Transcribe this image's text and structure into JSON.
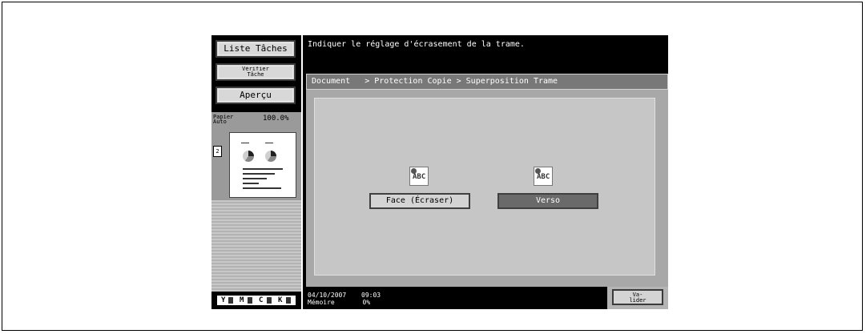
{
  "sidebar": {
    "job_list": "Liste Tâches",
    "check_job": [
      "Vérifier",
      "Tâche"
    ],
    "preview": "Aperçu",
    "paper": [
      "Papier",
      "Auto"
    ],
    "zoom": "100.0%",
    "duplex_icon": "duplex-icon",
    "toner": [
      "Y",
      "M",
      "C",
      "K"
    ]
  },
  "header": {
    "message": "Indiquer le réglage d'écrasement de la trame."
  },
  "breadcrumb": "Document   > Protection Copie > Superposition Trame",
  "options": {
    "face": {
      "label": "Face (Écraser)",
      "icon": "ABC",
      "selected": false
    },
    "verso": {
      "label": "Verso",
      "icon": "ABC",
      "selected": true
    }
  },
  "status": {
    "date": "04/10/2007",
    "time": "09:03",
    "memory_label": "Mémoire",
    "memory_value": "0%"
  },
  "valider": [
    "Va-",
    "lider"
  ]
}
